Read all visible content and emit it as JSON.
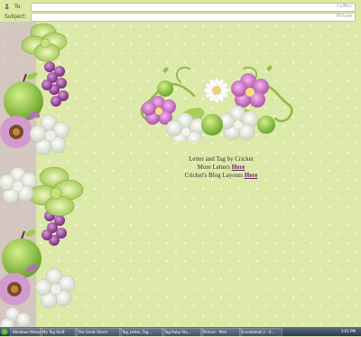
{
  "header": {
    "to": {
      "label": "To:",
      "dropdown": "Cc/Bcc"
    },
    "subject": {
      "label": "Subject:",
      "dropdown": "Picture"
    }
  },
  "message": {
    "line1": "Letter and Tag by Cricket",
    "line2_prefix": "More Letters",
    "line2_link": "Here",
    "line3_prefix": "Cricket's Blog Layouts",
    "line3_link": "Here"
  },
  "taskbar": {
    "items": [
      "Windows Messe...",
      "My Tag Stuff",
      "The Great Storm",
      "Tag_Letter_Tag...",
      "Tag Ruby Stu...",
      "Picture - Mail",
      "Incredimail 2 - E..."
    ],
    "clock": "3:01 PM"
  },
  "colors": {
    "paper": "#dde9a8",
    "link": "#6b1f6b",
    "apple_green": "#8cc63f",
    "pink_flower": "#c66fbf",
    "grape": "#9b4aa0"
  }
}
